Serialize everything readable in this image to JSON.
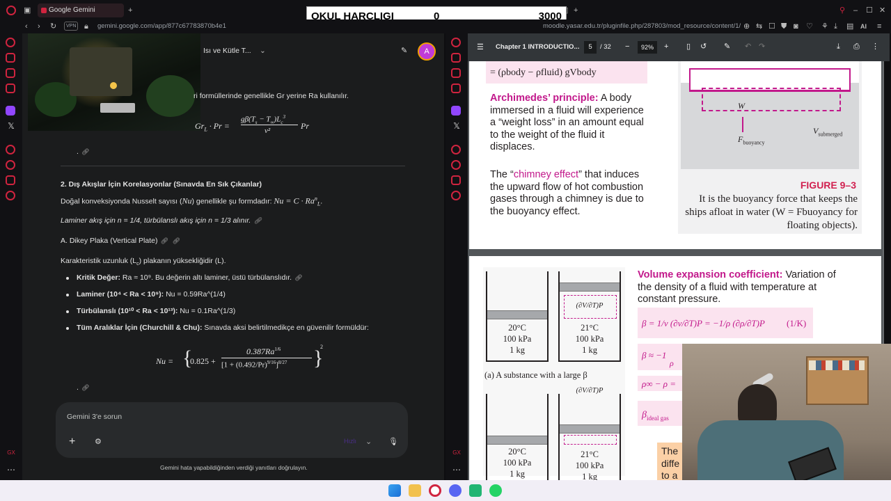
{
  "browser": {
    "left_tab_title": "Google Gemini",
    "left_url": "gemini.google.com/app/877c67783870b4e1",
    "right_url": "moodle.yasar.edu.tr/pluginfile.php/287803/mod_resource/content/1/",
    "vpn_label": "VPN",
    "ai_label": "AI",
    "gx_label": "GX"
  },
  "overlay": {
    "label": "OKUL HARCLIGI",
    "value": "0",
    "target": "3000"
  },
  "gemini": {
    "chat_title": "Isı ve Kütle T...",
    "avatar_letter": "A",
    "intro_text": "ri formüllerinde genellikle Gr yerine Ra kullanılır.",
    "formula_top": "Gr_L · Pr = gβ(Ts − T∞)Lc³ / ν² · Pr",
    "formula_top_lhs": "Gr",
    "formula_top_num": "gβ(T",
    "formula_top_den": "ν²",
    "formula_top_rhs": "Pr",
    "dot": ".",
    "section_heading": "2. Dış Akışlar İçin Korelasyonlar (Sınavda En Sık Çıkanlar)",
    "nusselt_line_a": "Doğal konveksiyonda Nusselt sayısı (",
    "nusselt_nu": "Nu",
    "nusselt_line_b": ") genellikle şu formdadır:",
    "nusselt_eq": "Nu = C · Ra",
    "nusselt_exp": "n",
    "nusselt_sub": "L",
    "laminar_line": "Laminer akış için n = 1/4, türbülanslı akış için n = 1/3 alınır.",
    "subheading": "A. Dikey Plaka (Vertical Plate)",
    "char_length": "Karakteristik uzunluk (L",
    "char_length_sub": "c",
    "char_length_b": ") plakanın yüksekliğidir (L).",
    "bullets": [
      {
        "bold": "Kritik Değer:",
        "text": " Ra ≈ 10⁹. Bu değerin altı laminer, üstü türbülanslıdır."
      },
      {
        "bold": "Laminer (10⁴ < Ra < 10⁹):",
        "text": " Nu = 0.59Ra^(1/4)"
      },
      {
        "bold": "Türbülanslı (10¹⁰ < Ra < 10¹³):",
        "text": " Nu = 0.1Ra^(1/3)"
      },
      {
        "bold": "Tüm Aralıklar İçin (Churchill & Chu):",
        "text": " Sınavda aksi belirtilmedikçe en güvenilir formüldür:"
      }
    ],
    "churchill_lhs": "Nu =",
    "churchill_a": "0.825 +",
    "churchill_num": "0.387Ra",
    "churchill_num_exp": "1/6",
    "churchill_den": "[1 + (0.492/Pr)",
    "churchill_den_exp": "9/16",
    "churchill_den_exp2": "8/27",
    "churchill_outer_exp": "2",
    "input_placeholder": "Gemini 3'e sorun",
    "model_label": "Hızlı",
    "disclaimer": "Gemini hata yapabildiğinden verdiği yanıtları doğrulayın."
  },
  "pdf": {
    "title": "Chapter 1 INTRODUCTIO...",
    "page_current": "5",
    "page_total": "/ 32",
    "zoom": "92%",
    "eq_top": "= (ρ",
    "eq_top_text": "= (ρbody − ρfluid) gVbody",
    "archimedes_title": "Archimedes’ principle:",
    "archimedes_body": "A body immersed in a fluid will experience a “weight loss” in an amount equal to the weight of the fluid it displaces.",
    "chimney_pre": "The “",
    "chimney_link": "chimney effect",
    "chimney_body": "” that induces the upward flow of hot combustion gases through a chimney is due to the buoyancy effect.",
    "figure_label": "FIGURE 9–3",
    "figure_caption": "It is the buoyancy force that keeps the ships afloat in water (W = Fbuoyancy for floating objects).",
    "ship_w": "W",
    "ship_f": "F",
    "ship_f_sub": "buoyancy",
    "ship_v": "V",
    "ship_v_sub": "submerged",
    "volume_title": "Volume expansion coefficient:",
    "volume_body": "Variation of the density of a fluid with temperature at constant pressure.",
    "beta_eq": "β = 1/v (∂v/∂T)P = −1/ρ (∂ρ/∂T)P",
    "beta_unit": "(1/K)",
    "beta_approx": "β ≈ −1",
    "beta_approx_den": "ρ",
    "rho_diff": "ρ∞ − ρ =",
    "beta_ideal": "β",
    "beta_ideal_sub": "ideal gas",
    "partial_label": "(∂V/∂T)P",
    "cyl_a_temp": "20°C",
    "cyl_a_p": "100 kPa",
    "cyl_a_m": "1 kg",
    "cyl_b_temp": "21°C",
    "cyl_b_p": "100 kPa",
    "cyl_b_m": "1 kg",
    "cyl_caption": "(a) A substance with a large β",
    "cyl_c_temp": "20°C",
    "cyl_c_p": "100 kPa",
    "cyl_c_m": "1 kg",
    "cyl_d_temp": "21°C",
    "cyl_d_p": "100 kPa",
    "cyl_d_m": "1 kg",
    "side_text": "The diffe to a"
  },
  "colors": {
    "accent_magenta": "#c2188b",
    "figure_red": "#d1204f",
    "opera_red": "#d0243f",
    "gemini_bg": "#1b1c1d"
  }
}
